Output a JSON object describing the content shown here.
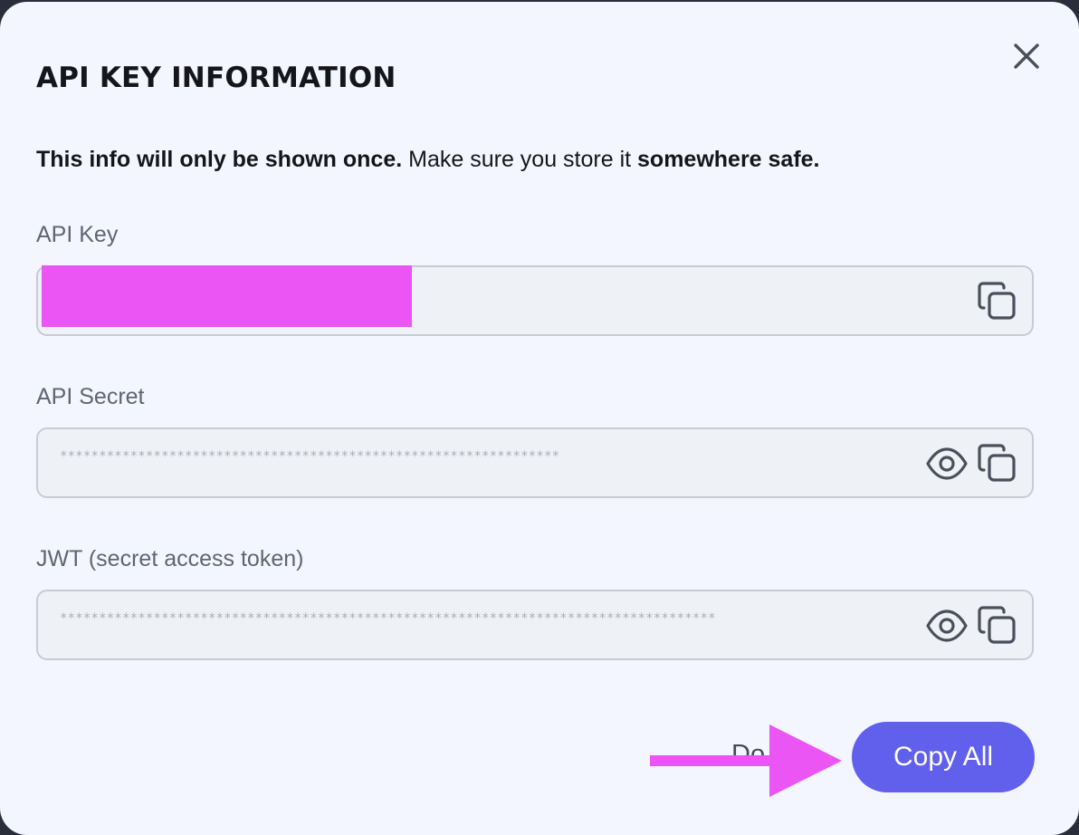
{
  "modal": {
    "title": "API KEY INFORMATION",
    "notice": {
      "bold_start": "This info will only be shown once.",
      "middle": " Make sure you store it ",
      "bold_end": "somewhere safe."
    }
  },
  "fields": {
    "api_key": {
      "label": "API Key",
      "value": ""
    },
    "api_secret": {
      "label": "API Secret",
      "value": "****************************************************************"
    },
    "jwt": {
      "label": "JWT (secret access token)",
      "value": "************************************************************************************"
    }
  },
  "buttons": {
    "done_label": "Do",
    "copy_all_label": "Copy All"
  },
  "icons": {
    "close": "close-icon",
    "copy": "copy-icon",
    "eye": "eye-icon",
    "annotation_arrow": "arrow-right-icon"
  },
  "colors": {
    "modal_bg": "#f3f6fe",
    "accent": "#6160ec",
    "redaction": "#ea55f4",
    "field_bg": "#eef1f6",
    "field_border": "#c7cbd3"
  }
}
